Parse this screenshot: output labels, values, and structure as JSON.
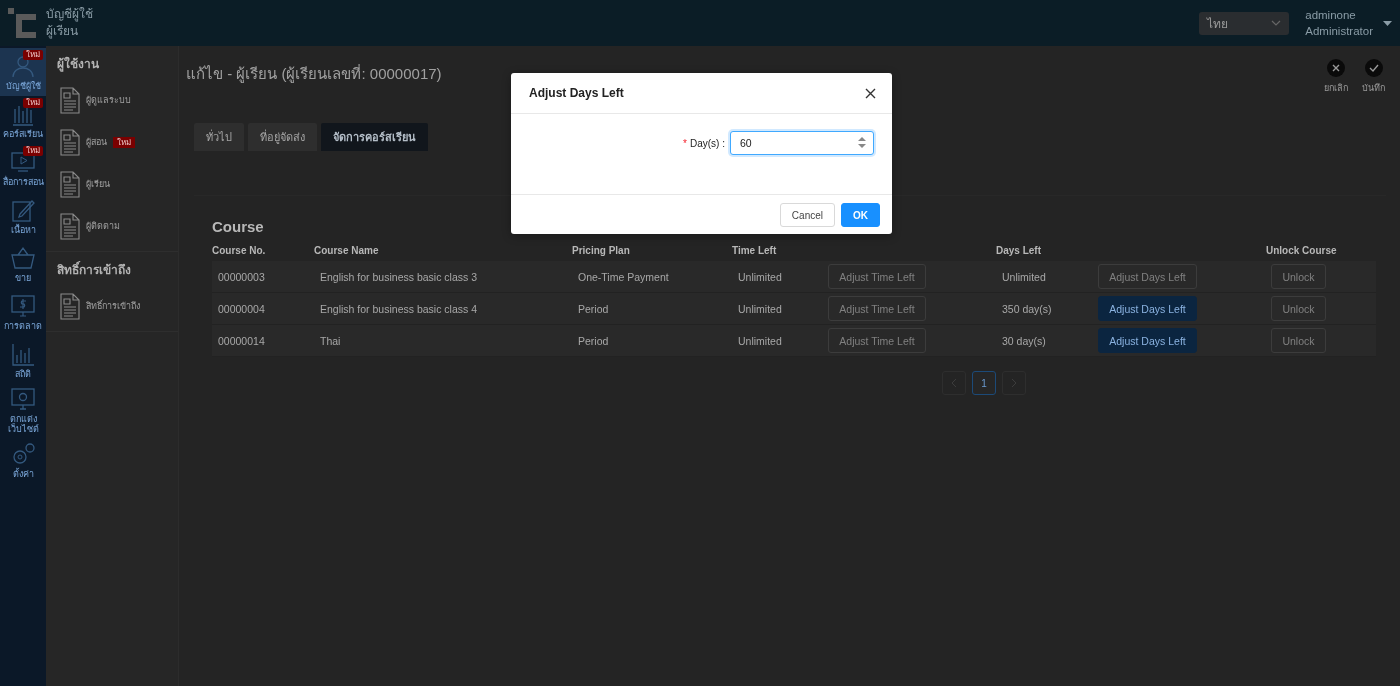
{
  "header": {
    "title_lines": [
      "บัญชีผู้ใช้",
      "ผู้เรียน"
    ],
    "language": {
      "value": "ไทย"
    },
    "user": {
      "name": "adminone",
      "role": "Administrator"
    }
  },
  "nav": [
    {
      "label": "บัญชีผู้ใช้",
      "badge": "ใหม่",
      "selected": true
    },
    {
      "label": "คอร์สเรียน",
      "badge": "ใหม่",
      "selected": false
    },
    {
      "label": "สื่อการสอน",
      "badge": "ใหม่",
      "selected": false
    },
    {
      "label": "เนื้อหา",
      "selected": false
    },
    {
      "label": "ขาย",
      "selected": false
    },
    {
      "label": "การตลาด",
      "selected": false
    },
    {
      "label": "สถิติ",
      "selected": false
    },
    {
      "label": "ตกแต่งเว็บไซต์",
      "selected": false
    },
    {
      "label": "ตั้งค่า",
      "selected": false
    }
  ],
  "submenu": [
    {
      "heading": "ผู้ใช้งาน",
      "items": [
        {
          "label": "ผู้ดูแลระบบ"
        },
        {
          "label": "ผู้สอน",
          "badge": "ใหม่"
        },
        {
          "label": "ผู้เรียน"
        },
        {
          "label": "ผู้ติดตาม"
        }
      ]
    },
    {
      "heading": "สิทธิ์การเข้าถึง",
      "items": [
        {
          "label": "สิทธิ์การเข้าถึง"
        }
      ]
    }
  ],
  "page": {
    "title": "แก้ไข - ผู้เรียน (ผู้เรียนเลขที่: 00000017)",
    "actions": [
      {
        "label": "ยกเลิก",
        "kind": "cancel"
      },
      {
        "label": "บันทึก",
        "kind": "save"
      }
    ],
    "tabs": [
      {
        "label": "ทั่วไป",
        "selected": false
      },
      {
        "label": "ที่อยู่จัดส่ง",
        "selected": false
      },
      {
        "label": "จัดการคอร์สเรียน",
        "selected": true
      }
    ]
  },
  "course_table": {
    "heading": "Course",
    "columns": [
      "Course No.",
      "Course Name",
      "Pricing Plan",
      "Time Left",
      "Days Left",
      "Unlock Course"
    ],
    "rows": [
      {
        "course_no": "00000003",
        "name": "English for business basic class 3",
        "plan": "One-Time Payment",
        "time_left": "Unlimited",
        "time_button": {
          "label": "Adjust Time Left",
          "disabled": true
        },
        "days_left": "Unlimited",
        "days_button": {
          "label": "Adjust Days Left",
          "disabled": true
        },
        "unlock_button": {
          "label": "Unlock",
          "disabled": true
        }
      },
      {
        "course_no": "00000004",
        "name": "English for business basic class 4",
        "plan": "Period",
        "time_left": "Unlimited",
        "time_button": {
          "label": "Adjust Time Left",
          "disabled": true
        },
        "days_left": "350 day(s)",
        "days_button": {
          "label": "Adjust Days Left",
          "disabled": false
        },
        "unlock_button": {
          "label": "Unlock",
          "disabled": true
        }
      },
      {
        "course_no": "00000014",
        "name": "Thai",
        "plan": "Period",
        "time_left": "Unlimited",
        "time_button": {
          "label": "Adjust Time Left",
          "disabled": true
        },
        "days_left": "30 day(s)",
        "days_button": {
          "label": "Adjust Days Left",
          "disabled": false
        },
        "unlock_button": {
          "label": "Unlock",
          "disabled": true
        }
      }
    ],
    "pagination": {
      "prev_disabled": true,
      "pages": [
        {
          "label": "1",
          "selected": true
        }
      ],
      "next_disabled": true
    }
  },
  "dialog": {
    "title": "Adjust Days Left",
    "field": {
      "required_mark": "*",
      "label": "Day(s) :",
      "value": "60"
    },
    "buttons": [
      {
        "label": "Cancel",
        "kind": "default"
      },
      {
        "label": "OK",
        "kind": "primary"
      }
    ]
  }
}
